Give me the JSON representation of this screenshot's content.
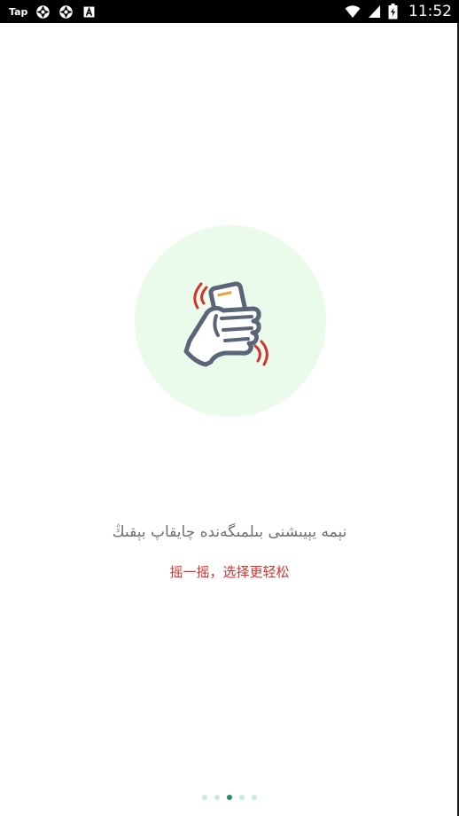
{
  "status_bar": {
    "app_label": "Tap",
    "time": "11:52",
    "icons": [
      "aperture-icon",
      "aperture-icon",
      "font-icon",
      "wifi-icon",
      "signal-icon",
      "battery-icon"
    ]
  },
  "intro": {
    "illustration": "hand-shaking-phone-icon",
    "title": "نېمە يېيىشنى بىلمىگەندە چايقاپ بېقىڭ",
    "subtitle": "摇一摇，选择更轻松"
  },
  "pager": {
    "count": 5,
    "active_index": 2
  },
  "colors": {
    "status_bar_bg": "#000000",
    "circle_bg": "#ebfbeb",
    "title_text": "#707070",
    "subtitle_text": "#d2332e",
    "dot_inactive": "#c9ece0",
    "dot_active": "#1e8f5a",
    "phone_body": "#5a6578",
    "shake_waves": "#d2332e",
    "phone_accent": "#e8a23a"
  }
}
